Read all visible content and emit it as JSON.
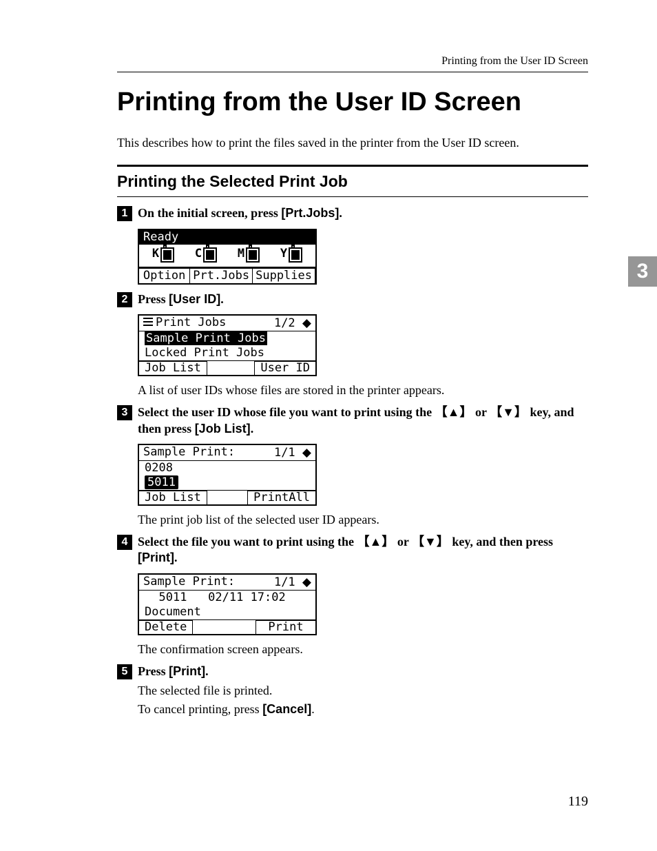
{
  "running_head": "Printing from the User ID Screen",
  "title": "Printing from the User ID Screen",
  "lead": "This describes how to print the files saved in the printer from the User ID screen.",
  "subhead": "Printing the Selected Print Job",
  "thumb_tab": "3",
  "page_number": "119",
  "step1": {
    "num": "1",
    "text_pre": "On the initial screen, press ",
    "button": "[Prt.Jobs]",
    "text_post": "."
  },
  "lcd1": {
    "status": "Ready",
    "k": "K",
    "c": "C",
    "m": "M",
    "y": "Y",
    "opt": "Option",
    "prt": "Prt.Jobs",
    "sup": "Supplies"
  },
  "step2": {
    "num": "2",
    "text_pre": "Press ",
    "button": "[User ID]",
    "text_post": "."
  },
  "lcd2": {
    "title": "Print Jobs",
    "page": "1/2",
    "item1": "Sample Print Jobs",
    "item2": "Locked Print Jobs",
    "left_btn": "Job List",
    "right_btn": "User ID"
  },
  "follow2": "A list of user IDs whose files are stored in the printer appears.",
  "step3": {
    "num": "3",
    "text_a": "Select the user ID whose file you want to print using the ",
    "key_up": "【▲】",
    "text_or": " or ",
    "key_dn": "【▼】",
    "text_b": " key, and then press ",
    "button": "[Job List]",
    "text_c": "."
  },
  "lcd3": {
    "title": "Sample Print:",
    "page": "1/1",
    "item1": "0208",
    "item2": "5011",
    "left_btn": "Job List",
    "right_btn": "PrintAll"
  },
  "follow3": "The print job list of the selected user ID appears.",
  "step4": {
    "num": "4",
    "text_a": "Select the file you want to print using the ",
    "key_up": "【▲】",
    "text_or": " or ",
    "key_dn": "【▼】",
    "text_b": " key, and then press ",
    "button": "[Print]",
    "text_c": "."
  },
  "lcd4": {
    "title": "Sample Print:",
    "page": "1/1",
    "id": "5011",
    "ts": "02/11 17:02",
    "item2": "Document",
    "left_btn": "Delete",
    "right_btn": "Print"
  },
  "follow4": "The confirmation screen appears.",
  "step5": {
    "num": "5",
    "text_pre": "Press ",
    "button": "[Print]",
    "text_post": "."
  },
  "follow5a": "The selected file is printed.",
  "follow5b_pre": "To cancel printing, press ",
  "follow5b_btn": "[Cancel]",
  "follow5b_post": "."
}
